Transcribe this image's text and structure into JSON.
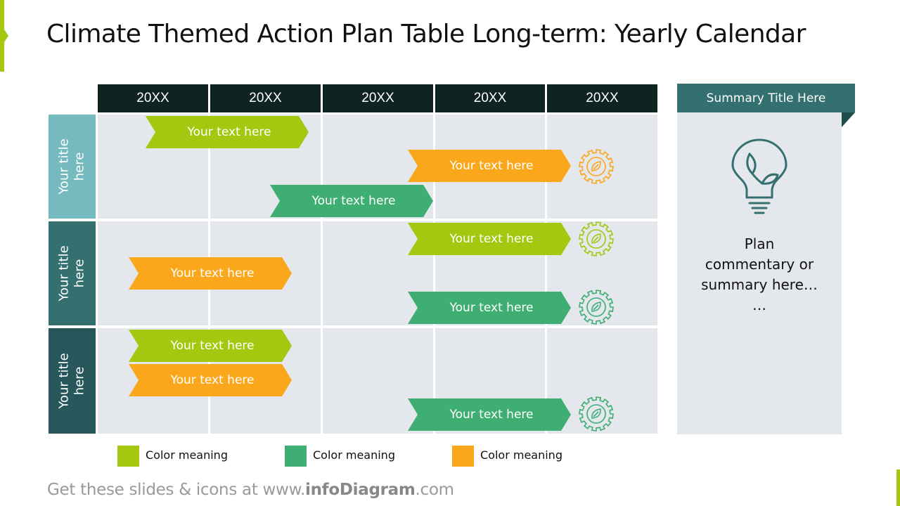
{
  "title": "Climate Themed Action Plan Table Long-term: Yearly Calendar",
  "colors": {
    "lime": "#a4c70f",
    "green": "#3fae73",
    "orange": "#fba71b",
    "header_dark": "#0e2421",
    "row1": "#75babe",
    "row2": "#34706f",
    "row3": "#27575b",
    "summary_head": "#34706f",
    "cell": "#e4e7ec"
  },
  "years": [
    "20XX",
    "20XX",
    "20XX",
    "20XX",
    "20XX"
  ],
  "rows": [
    {
      "title": "Your title\nhere"
    },
    {
      "title": "Your title\nhere"
    },
    {
      "title": "Your title\nhere"
    }
  ],
  "bars": [
    {
      "label": "Your text here",
      "color": "lime"
    },
    {
      "label": "Your text here",
      "color": "orange",
      "icon": "gear-leaf-icon"
    },
    {
      "label": "Your text here",
      "color": "green"
    },
    {
      "label": "Your text here",
      "color": "lime",
      "icon": "gear-leaf-icon"
    },
    {
      "label": "Your text here",
      "color": "orange"
    },
    {
      "label": "Your text here",
      "color": "green",
      "icon": "gear-leaf-icon"
    },
    {
      "label": "Your text here",
      "color": "lime"
    },
    {
      "label": "Your text here",
      "color": "orange"
    },
    {
      "label": "Your text here",
      "color": "green",
      "icon": "gear-leaf-icon"
    }
  ],
  "summary": {
    "title": "Summary Title Here",
    "icon": "lightbulb-leaf-icon",
    "text": "Plan\ncommentary or\nsummary here…\n…"
  },
  "legend": [
    {
      "label": "Color meaning",
      "color": "lime"
    },
    {
      "label": "Color meaning",
      "color": "green"
    },
    {
      "label": "Color meaning",
      "color": "orange"
    }
  ],
  "footer": {
    "prefix": "Get these slides & icons at www.",
    "brand": "infoDiagram",
    "suffix": ".com"
  }
}
